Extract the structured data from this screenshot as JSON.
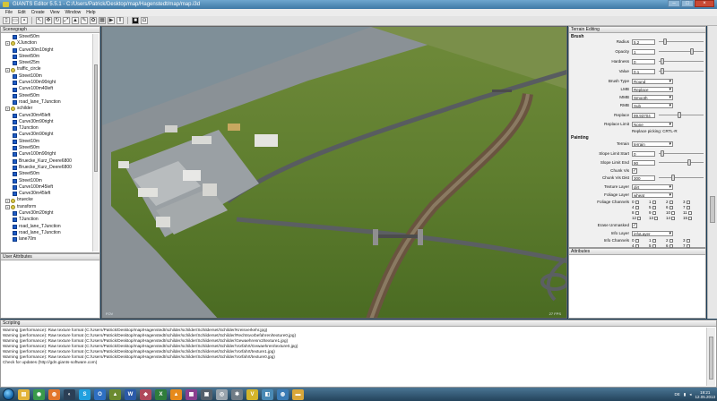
{
  "window": {
    "title": "GIANTS Editor 5.5.1 - C:/Users/Patrick/Desktop/map/Hagenstedt/map/map.i3d"
  },
  "menu": [
    "File",
    "Edit",
    "Create",
    "View",
    "Window",
    "Help"
  ],
  "scenegraph": {
    "title": "Scenegraph",
    "items": [
      {
        "label": "Street50m",
        "type": "node"
      },
      {
        "label": "XJunction",
        "type": "group"
      },
      {
        "label": "Curve30m10right",
        "type": "node"
      },
      {
        "label": "Street50m",
        "type": "node"
      },
      {
        "label": "Street25m",
        "type": "node"
      },
      {
        "label": "traffic_circle",
        "type": "group"
      },
      {
        "label": "Street100m",
        "type": "node"
      },
      {
        "label": "Curve100m90right",
        "type": "node"
      },
      {
        "label": "Curve100m40left",
        "type": "node"
      },
      {
        "label": "Street50m",
        "type": "node"
      },
      {
        "label": "road_lane_TJunction",
        "type": "node"
      },
      {
        "label": "schilder",
        "type": "group"
      },
      {
        "label": "Curve30m45left",
        "type": "node"
      },
      {
        "label": "Curve30m90right",
        "type": "node"
      },
      {
        "label": "TJunction",
        "type": "node"
      },
      {
        "label": "Curve30m90right",
        "type": "node"
      },
      {
        "label": "Street10m",
        "type": "node"
      },
      {
        "label": "Street50m",
        "type": "node"
      },
      {
        "label": "Curve100m90right",
        "type": "node"
      },
      {
        "label": "Bruecke_Kurz_Deere6800",
        "type": "node"
      },
      {
        "label": "Bruecke_Kurz_Deere6800",
        "type": "node"
      },
      {
        "label": "Street50m",
        "type": "node"
      },
      {
        "label": "Street100m",
        "type": "node"
      },
      {
        "label": "Curve100m45left",
        "type": "node"
      },
      {
        "label": "Curve30m45left",
        "type": "node"
      },
      {
        "label": "bruecke",
        "type": "group"
      },
      {
        "label": "transform",
        "type": "group"
      },
      {
        "label": "Curve30m20right",
        "type": "node"
      },
      {
        "label": "TJunction",
        "type": "node"
      },
      {
        "label": "road_lane_TJunction",
        "type": "node"
      },
      {
        "label": "road_lane_TJunction",
        "type": "node"
      },
      {
        "label": "lane70m",
        "type": "node"
      }
    ]
  },
  "user_attributes": {
    "title": "User Attributes"
  },
  "viewport": {
    "left_label": "FOV",
    "right_label": "27 FPS"
  },
  "terrain": {
    "title": "Terrain Editing",
    "brush_section": "Brush",
    "radius": {
      "label": "Radius",
      "value": "5.2",
      "level": 0.1
    },
    "opacity": {
      "label": "Opacity",
      "value": "1",
      "level": 0.75
    },
    "hardness": {
      "label": "Hardness",
      "value": "0",
      "level": 0.05
    },
    "value": {
      "label": "Value",
      "value": "0.1",
      "level": 0.05
    },
    "brush_type": {
      "label": "Brush Type",
      "value": "Round"
    },
    "lmb": {
      "label": "LMB",
      "value": "Replace"
    },
    "mmb": {
      "label": "MMB",
      "value": "Smooth"
    },
    "rmb": {
      "label": "RMB",
      "value": "Sub"
    },
    "replace": {
      "label": "Replace",
      "value": "99.93704",
      "level": 0.45
    },
    "replace_limit": {
      "label": "Replace Limit",
      "value": "None"
    },
    "replace_picking": "Replace picking: CRTL-R",
    "painting_section": "Painting",
    "terrain": {
      "label": "Terrain",
      "value": "terrain"
    },
    "slope_start": {
      "label": "Slope Limit Start",
      "value": "0",
      "level": 0.05
    },
    "slope_end": {
      "label": "Slope Limit End",
      "value": "90",
      "level": 0.7
    },
    "chunk_vis": {
      "label": "Chunk Vis",
      "checked": true
    },
    "chunk_vis_dist": {
      "label": "Chunk Vis Dist",
      "value": "300",
      "level": 0.3
    },
    "texture_layer": {
      "label": "Texture Layer",
      "value": "dirt"
    },
    "foliage_layer": {
      "label": "Foliage Layer",
      "value": "wheat"
    },
    "foliage_channels": {
      "label": "Foliage Channels",
      "cells": [
        "0",
        "1",
        "2",
        "3",
        "4",
        "5",
        "6",
        "7",
        "8",
        "9",
        "10",
        "11",
        "12",
        "13",
        "14",
        "15"
      ]
    },
    "erase_unmasked": {
      "label": "Erase Unmasked",
      "checked": true
    },
    "info_layer": {
      "label": "Info Layer",
      "value": "infoLayer"
    },
    "info_channels": {
      "label": "Info Channels",
      "cells": [
        "0",
        "1",
        "2",
        "3",
        "4",
        "5",
        "6",
        "7"
      ]
    }
  },
  "attributes": {
    "title": "Attributes"
  },
  "scripting": {
    "title": "Scripting",
    "lines": [
      "Warning (performance): Raw texture format (C:/Users/Patrick/Desktop/map/Hagenstedt/schilder/schilder/Schilderset/Schilder/Kreisverkehr.jpg)",
      "Warning (performance): Raw texture format (C:/Users/Patrick/Desktop/map/Hagenstedt/schilder/schilder/Schilderset/Schilder/Rechtsvorbefahren/texture0.jpg)",
      "Warning (performance): Raw texture format (C:/Users/Patrick/Desktop/map/Hagenstedt/schilder/schilder/Schilderset/Schilder/Gewaehrenrv2/texture1.jpg)",
      "Warning (performance): Raw texture format (C:/Users/Patrick/Desktop/map/Hagenstedt/schilder/schilder/Schilderset/Schilder/Vorfahrt/Gewaehren/texture0.jpg)",
      "Warning (performance): Raw texture format (C:/Users/Patrick/Desktop/map/Hagenstedt/schilder/schilder/Schilderset/Schilder/Vorfahrt/texture1.jpg)",
      "Warning (performance): Raw texture format (C:/Users/Patrick/Desktop/map/Hagenstedt/schilder/schilder/Schilderset/Schilder/Vorfahrt/texture0.jpg)",
      "Check for updates (http://gdn.giants-software.com)"
    ]
  },
  "taskbar": {
    "apps": [
      {
        "icon": "explorer-icon",
        "glyph": "▤",
        "color": "#e2b33a"
      },
      {
        "icon": "chrome-icon",
        "glyph": "◉",
        "color": "#3a9a4a"
      },
      {
        "icon": "firefox-icon",
        "glyph": "◍",
        "color": "#e2762b"
      },
      {
        "icon": "steam-icon",
        "glyph": "◐",
        "color": "#2b3f55"
      },
      {
        "icon": "skype-icon",
        "glyph": "S",
        "color": "#20a0df"
      },
      {
        "icon": "outlook-icon",
        "glyph": "O",
        "color": "#2e6fc2"
      },
      {
        "icon": "game-icon",
        "glyph": "▲",
        "color": "#6b8a2f"
      },
      {
        "icon": "word-icon",
        "glyph": "W",
        "color": "#2b5aa8"
      },
      {
        "icon": "picture-icon",
        "glyph": "◆",
        "color": "#b0495c"
      },
      {
        "icon": "excel-icon",
        "glyph": "X",
        "color": "#2f7d3b"
      },
      {
        "icon": "vlc-icon",
        "glyph": "▲",
        "color": "#e68a1c"
      },
      {
        "icon": "winrar-icon",
        "glyph": "▦",
        "color": "#8a3f8f"
      },
      {
        "icon": "media-icon",
        "glyph": "▣",
        "color": "#55606b"
      },
      {
        "icon": "disc-icon",
        "glyph": "◎",
        "color": "#9aa4ad"
      },
      {
        "icon": "tool-icon",
        "glyph": "✱",
        "color": "#707c86"
      },
      {
        "icon": "giants-icon",
        "glyph": "V",
        "color": "#d4b52a"
      },
      {
        "icon": "paint-icon",
        "glyph": "◧",
        "color": "#4a8ab5"
      },
      {
        "icon": "globe-icon",
        "glyph": "◍",
        "color": "#3b7bb5"
      },
      {
        "icon": "folder-icon",
        "glyph": "▬",
        "color": "#d9a73a"
      }
    ],
    "lang": "DE",
    "time": "19:21",
    "date": "12.05.2013"
  }
}
